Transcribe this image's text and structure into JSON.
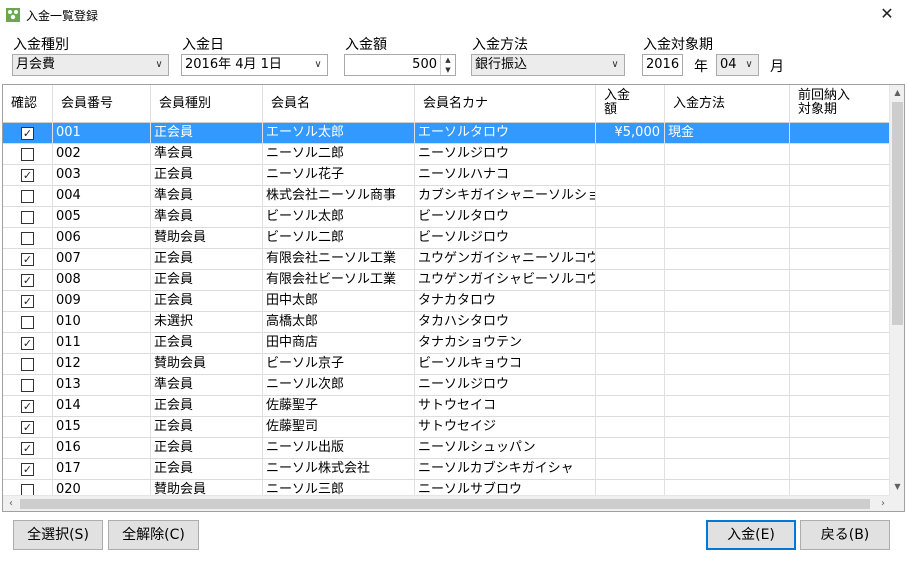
{
  "window": {
    "title": "入金一覧登録",
    "close": "✕"
  },
  "filters": {
    "kind_label": "入金種別",
    "kind_value": "月会費",
    "date_label": "入金日",
    "date_value": "2016年  4月  1日",
    "amount_label": "入金額",
    "amount_value": "500",
    "method_label": "入金方法",
    "method_value": "銀行振込",
    "period_label": "入金対象期",
    "period_year": "2016",
    "year_unit": "年",
    "period_month": "04",
    "month_unit": "月"
  },
  "table": {
    "headers": {
      "confirm": "確認",
      "member_no": "会員番号",
      "member_type": "会員種別",
      "member_name": "会員名",
      "member_kana": "会員名カナ",
      "amount_l1": "入金",
      "amount_l2": "額",
      "method": "入金方法",
      "prev_l1": "前回納入",
      "prev_l2": "対象期"
    },
    "rows": [
      {
        "checked": true,
        "no": "001",
        "type": "正会員",
        "name": "エーソル太郎",
        "kana": "エーソルタロウ",
        "amount": "¥5,000",
        "method": "現金",
        "prev": "",
        "selected": true
      },
      {
        "checked": false,
        "no": "002",
        "type": "準会員",
        "name": "ニーソル二郎",
        "kana": "ニーソルジロウ",
        "amount": "",
        "method": "",
        "prev": ""
      },
      {
        "checked": true,
        "no": "003",
        "type": "正会員",
        "name": "ニーソル花子",
        "kana": "ニーソルハナコ",
        "amount": "",
        "method": "",
        "prev": ""
      },
      {
        "checked": false,
        "no": "004",
        "type": "準会員",
        "name": "株式会社ニーソル商事",
        "kana": "カブシキガイシャニーソルショ...",
        "amount": "",
        "method": "",
        "prev": ""
      },
      {
        "checked": false,
        "no": "005",
        "type": "準会員",
        "name": "ビーソル太郎",
        "kana": "ビーソルタロウ",
        "amount": "",
        "method": "",
        "prev": ""
      },
      {
        "checked": false,
        "no": "006",
        "type": "賛助会員",
        "name": "ビーソル二郎",
        "kana": "ビーソルジロウ",
        "amount": "",
        "method": "",
        "prev": ""
      },
      {
        "checked": true,
        "no": "007",
        "type": "正会員",
        "name": "有限会社ニーソル工業",
        "kana": "ユウゲンガイシャニーソルコウ...",
        "amount": "",
        "method": "",
        "prev": ""
      },
      {
        "checked": true,
        "no": "008",
        "type": "正会員",
        "name": "有限会社ビーソル工業",
        "kana": "ユウゲンガイシャビーソルコウ...",
        "amount": "",
        "method": "",
        "prev": ""
      },
      {
        "checked": true,
        "no": "009",
        "type": "正会員",
        "name": "田中太郎",
        "kana": "タナカタロウ",
        "amount": "",
        "method": "",
        "prev": ""
      },
      {
        "checked": false,
        "no": "010",
        "type": "未選択",
        "name": "高橋太郎",
        "kana": "タカハシタロウ",
        "amount": "",
        "method": "",
        "prev": ""
      },
      {
        "checked": true,
        "no": "011",
        "type": "正会員",
        "name": "田中商店",
        "kana": "タナカショウテン",
        "amount": "",
        "method": "",
        "prev": ""
      },
      {
        "checked": false,
        "no": "012",
        "type": "賛助会員",
        "name": "ビーソル京子",
        "kana": "ビーソルキョウコ",
        "amount": "",
        "method": "",
        "prev": ""
      },
      {
        "checked": false,
        "no": "013",
        "type": "準会員",
        "name": "ニーソル次郎",
        "kana": "ニーソルジロウ",
        "amount": "",
        "method": "",
        "prev": ""
      },
      {
        "checked": true,
        "no": "014",
        "type": "正会員",
        "name": "佐藤聖子",
        "kana": "サトウセイコ",
        "amount": "",
        "method": "",
        "prev": ""
      },
      {
        "checked": true,
        "no": "015",
        "type": "正会員",
        "name": "佐藤聖司",
        "kana": "サトウセイジ",
        "amount": "",
        "method": "",
        "prev": ""
      },
      {
        "checked": true,
        "no": "016",
        "type": "正会員",
        "name": "ニーソル出版",
        "kana": "ニーソルシュッパン",
        "amount": "",
        "method": "",
        "prev": ""
      },
      {
        "checked": true,
        "no": "017",
        "type": "正会員",
        "name": "ニーソル株式会社",
        "kana": "ニーソルカブシキガイシャ",
        "amount": "",
        "method": "",
        "prev": ""
      },
      {
        "checked": false,
        "no": "020",
        "type": "賛助会員",
        "name": "ニーソル三郎",
        "kana": "ニーソルサブロウ",
        "amount": "",
        "method": "",
        "prev": ""
      }
    ]
  },
  "buttons": {
    "select_all": "全選択(S)",
    "clear_all": "全解除(C)",
    "deposit": "入金(E)",
    "back": "戻る(B)"
  }
}
